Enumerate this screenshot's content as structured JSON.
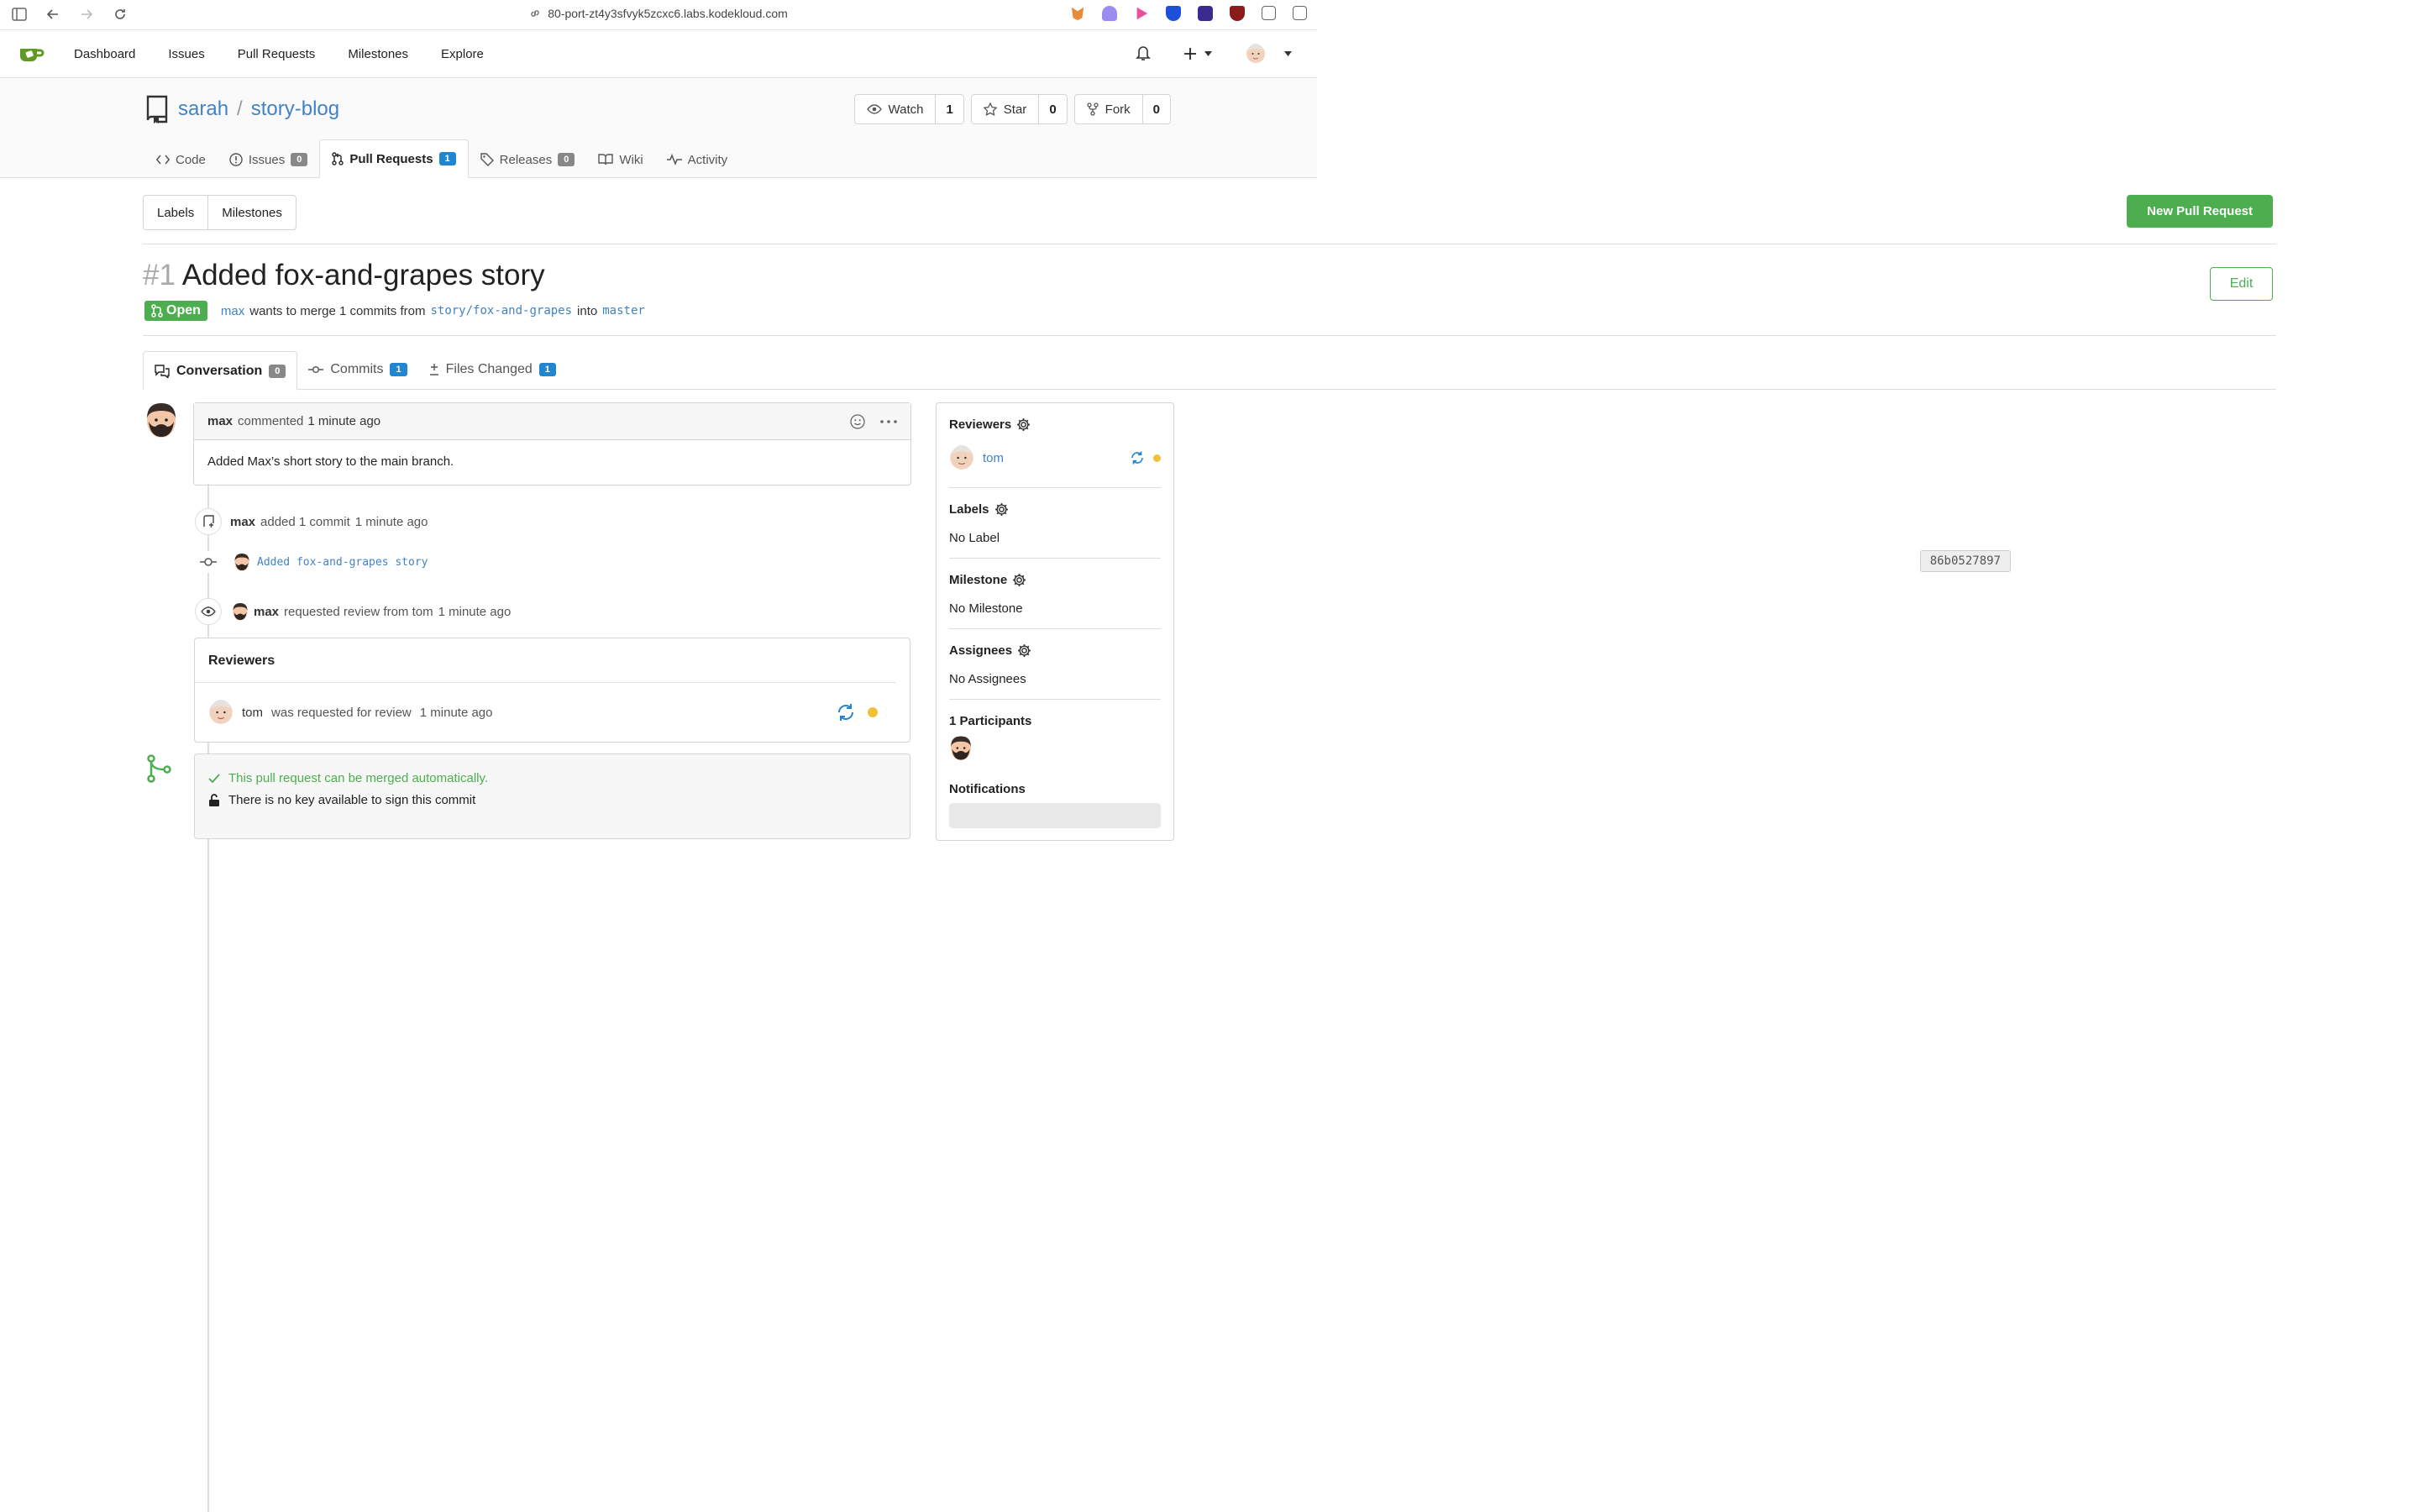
{
  "browser": {
    "url": "80-port-zt4y3sfvyk5zcxc6.labs.kodekloud.com"
  },
  "nav": {
    "links": [
      "Dashboard",
      "Issues",
      "Pull Requests",
      "Milestones",
      "Explore"
    ]
  },
  "repo": {
    "owner": "sarah",
    "separator": "/",
    "name": "story-blog",
    "watch_label": "Watch",
    "watch_count": "1",
    "star_label": "Star",
    "star_count": "0",
    "fork_label": "Fork",
    "fork_count": "0",
    "tabs": {
      "code": "Code",
      "issues": "Issues",
      "issues_count": "0",
      "pulls": "Pull Requests",
      "pulls_count": "1",
      "releases": "Releases",
      "releases_count": "0",
      "wiki": "Wiki",
      "activity": "Activity"
    }
  },
  "subbar": {
    "labels": "Labels",
    "milestones": "Milestones",
    "new_pr": "New Pull Request"
  },
  "pr": {
    "number": "#1",
    "title": "Added fox-and-grapes story",
    "edit": "Edit",
    "status": "Open",
    "author": "max",
    "meta_text": "wants to merge 1 commits from",
    "head_branch": "story/fox-and-grapes",
    "into": "into",
    "base_branch": "master",
    "tabs": {
      "conversation": "Conversation",
      "conversation_count": "0",
      "commits": "Commits",
      "commits_count": "1",
      "files": "Files Changed",
      "files_count": "1"
    }
  },
  "comment": {
    "author": "max",
    "action": "commented",
    "time": "1 minute ago",
    "body": "Added Max’s short story to the main branch."
  },
  "timeline": {
    "commit_event": {
      "author": "max",
      "text": "added 1 commit",
      "time": "1 minute ago"
    },
    "commit": {
      "message": "Added fox-and-grapes story",
      "sha": "86b0527897"
    },
    "review_request": {
      "author": "max",
      "text": "requested review from tom",
      "time": "1 minute ago"
    },
    "reviewers_box": {
      "title": "Reviewers",
      "row_user": "tom",
      "row_text": "was requested for review",
      "row_time": "1 minute ago"
    },
    "merge": {
      "ok": "This pull request can be merged automatically.",
      "nokey": "There is no key available to sign this commit"
    }
  },
  "sidebar": {
    "reviewers_title": "Reviewers",
    "reviewer": "tom",
    "labels_title": "Labels",
    "labels_value": "No Label",
    "milestone_title": "Milestone",
    "milestone_value": "No Milestone",
    "assignees_title": "Assignees",
    "assignees_value": "No Assignees",
    "participants_title": "1 Participants",
    "notifications_title": "Notifications"
  },
  "colors": {
    "accent_green": "#4cae4f",
    "link_blue": "#4183c4",
    "badge_blue": "#2185d0",
    "pending_yellow": "#f2c037"
  }
}
